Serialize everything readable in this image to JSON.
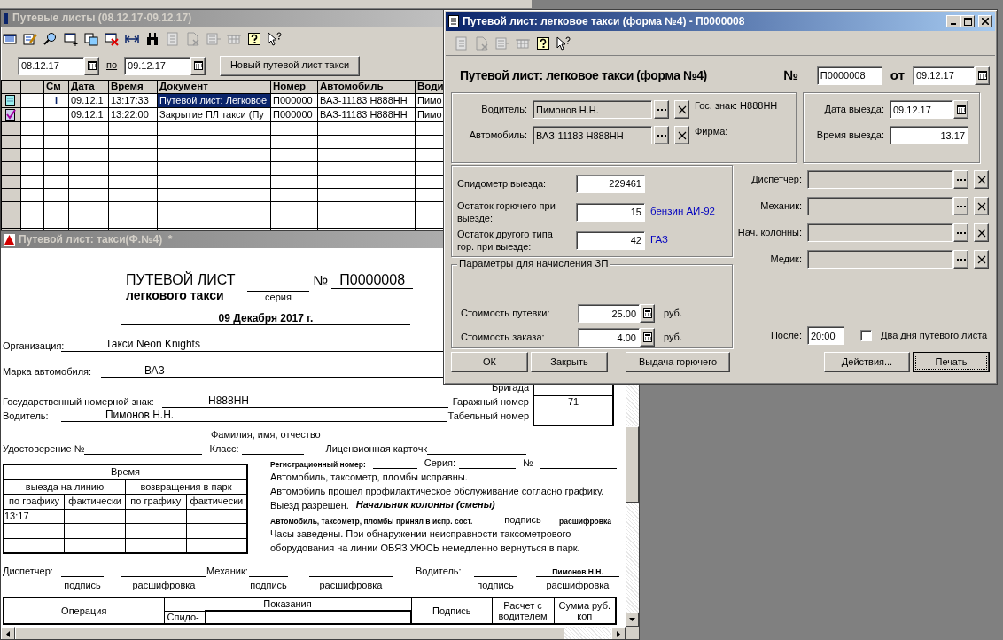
{
  "list_window": {
    "title": "Путевые листы (08.12.17-09.12.17)",
    "date_from": "08.12.17",
    "to_label": "по",
    "date_to": "09.12.17",
    "new_button": "Новый путевой лист такси",
    "table": {
      "columns": [
        "См",
        "Дата",
        "Время",
        "Документ",
        "Номер",
        "Автомобиль",
        "Води"
      ],
      "rows": [
        {
          "kind": "waybill",
          "selected": true,
          "mark": "I",
          "date": "09.12.1",
          "time": "13:17:33",
          "document": "Путевой лист: Легковое",
          "number": "П000000",
          "car": "ВАЗ-11183 Н888НН",
          "driver": "Пимо"
        },
        {
          "kind": "closing",
          "selected": false,
          "date": "09.12.1",
          "time": "13:22:00",
          "document": "Закрытие ПЛ такси (Пу",
          "number": "П000000",
          "car": "ВАЗ-11183 Н888НН",
          "driver": "Пимо"
        }
      ]
    }
  },
  "print_window": {
    "title": "Путевой лист: такси(Ф.№4)  *",
    "form": {
      "title_1": "ПУТЕВОЙ ЛИСТ",
      "title_2": "легкового такси",
      "series_label": "серия",
      "number_sign": "№",
      "number": "П0000008",
      "date": "09 Декабря 2017 г.",
      "org_label": "Организация:",
      "org": "Такси Neon Knights",
      "brand_label": "Марка автомобиля:",
      "brand": "ВАЗ",
      "brigade_label": "Бригада",
      "plate_label": "Государственный номерной знак:",
      "plate": "Н888НН",
      "garage_label": "Гаражный номер",
      "garage": "71",
      "driver_label": "Водитель:",
      "driver": "Пимонов Н.Н.",
      "tab_label": "Табельный номер",
      "fio_caption": "Фамилия, имя, отчество",
      "license_label": "Удостоверение №",
      "class_label": "Класс:",
      "card_label": "Лицензионная карточк",
      "time_table": {
        "title": "Время",
        "groups": [
          "выезда на линию",
          "возвращения в парк"
        ],
        "subcolumns": [
          "по графику",
          "фактически",
          "по графику",
          "фактически"
        ],
        "first_value": "13:17"
      },
      "reg_label": "Регистрационный номер:",
      "reg_series_label": "Серия:",
      "reg_no_label": "№",
      "note_1": "Автомобиль, таксометр, пломбы исправны.",
      "note_2": "Автомобиль прошел профилактическое обслуживание согласно графику.",
      "exit_label": "Выезд разрешен.",
      "chief": "Начальник колонны (смены)",
      "accepted": "Автомобиль, таксометр, пломбы принял в испр. сост.",
      "sign_caption": "подпись",
      "decode_caption": "расшифровка",
      "note_3": "Часы заведены. При обнаружении неисправности таксометрового",
      "note_4": "оборудования на линии ОБЯЗ УЮСЬ немедленно вернуться в парк.",
      "signatures": [
        {
          "label": "Диспетчер:",
          "sign": "подпись",
          "decode": "расшифровка"
        },
        {
          "label": "Механик:",
          "sign": "подпись",
          "decode": "расшифровка"
        },
        {
          "label": "Водитель:",
          "sign": "подпись",
          "name": "Пимонов Н.Н.",
          "decode": "расшифровка"
        }
      ],
      "ops_table": {
        "operation": "Операция",
        "readings": "Показания",
        "speedo": "Спидо-",
        "signature": "Подпись",
        "settlement": "Расчет с водителем",
        "sum": "Сумма руб. коп"
      }
    }
  },
  "dialog": {
    "title": "Путевой лист: легковое такси (форма №4) - П0000008",
    "heading": "Путевой лист: легковое такси (форма №4)",
    "number_label": "№",
    "number": "П0000008",
    "date_label": "от",
    "date": "09.12.17",
    "driver": {
      "label": "Водитель:",
      "value": "Пимонов Н.Н.",
      "note": "Гос. знак: Н888НН"
    },
    "car": {
      "label": "Автомобиль:",
      "value": "ВАЗ-11183 Н888НН",
      "note": "Фирма:"
    },
    "departure_date": {
      "label": "Дата выезда:",
      "value": "09.12.17"
    },
    "departure_time": {
      "label": "Время выезда:",
      "value": "13.17"
    },
    "readings": [
      {
        "label": "Спидометр выезда:",
        "value": "229461"
      },
      {
        "label": "Остаток горючего при выезде:",
        "value": "15",
        "unit": "бензин АИ-92"
      },
      {
        "label": "Остаток другого типа гор. при выезде:",
        "value": "42",
        "unit": "ГАЗ"
      }
    ],
    "pay": {
      "legend": "Параметры для начисления ЗП",
      "rows": [
        {
          "label": "Стоимость путевки:",
          "value": "25.00",
          "unit": "руб."
        },
        {
          "label": "Стоимость заказа:",
          "value": "4.00",
          "unit": "руб."
        }
      ]
    },
    "staff": [
      {
        "label": "Диспетчер:"
      },
      {
        "label": "Механик:"
      },
      {
        "label": "Нач. колонны:"
      },
      {
        "label": "Медик:"
      }
    ],
    "after": {
      "label": "После:",
      "value": "20:00"
    },
    "two_days": {
      "label": "Два дня путевого листа",
      "checked": false
    },
    "buttons": [
      {
        "label": "ОК",
        "focused": false
      },
      {
        "label": "Закрыть",
        "focused": false
      },
      {
        "label": "Выдача горючего",
        "focused": false
      },
      {
        "label": "Действия...",
        "focused": false
      },
      {
        "label": "Печать",
        "focused": true
      }
    ]
  }
}
